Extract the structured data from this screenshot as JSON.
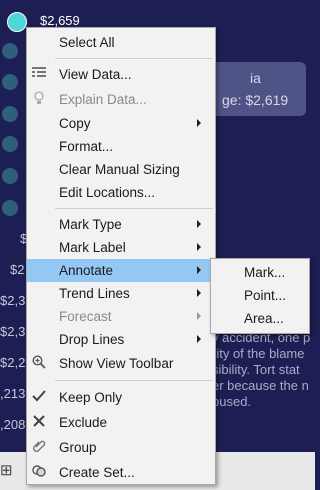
{
  "background": {
    "active_value": "$2,659",
    "tooltip_partial_1": "ia",
    "tooltip_partial_2": "ge: $2,619",
    "left_values": [
      "$",
      "$2",
      "$2,3",
      "$2,3",
      "$2,27",
      ",213",
      ",208"
    ],
    "paragraph_lines": [
      "y accident, one p",
      "rity of the blame",
      "sibility. Tort stat",
      "er because the n",
      "bused."
    ]
  },
  "colors": {
    "background": "#1d1f54",
    "active_dot": "#4fd6d6",
    "menu_highlight": "#93c8f4"
  },
  "menu": {
    "items": [
      {
        "label": "Select All"
      },
      {
        "label": "View Data...",
        "icon": "table-icon"
      },
      {
        "label": "Explain Data...",
        "icon": "lightbulb-icon",
        "disabled": true
      },
      {
        "label": "Copy",
        "submenu": true
      },
      {
        "label": "Format..."
      },
      {
        "label": "Clear Manual Sizing"
      },
      {
        "label": "Edit Locations..."
      },
      {
        "label": "Mark Type",
        "submenu": true
      },
      {
        "label": "Mark Label",
        "submenu": true
      },
      {
        "label": "Annotate",
        "submenu": true,
        "highlighted": true
      },
      {
        "label": "Trend Lines",
        "submenu": true
      },
      {
        "label": "Forecast",
        "submenu": true,
        "disabled": true
      },
      {
        "label": "Drop Lines",
        "submenu": true
      },
      {
        "label": "Show View Toolbar",
        "icon": "zoom-in-icon"
      },
      {
        "label": "Keep Only",
        "icon": "checkmark-icon"
      },
      {
        "label": "Exclude",
        "icon": "x-icon"
      },
      {
        "label": "Group",
        "icon": "paperclip-icon"
      },
      {
        "label": "Create Set...",
        "icon": "set-icon"
      }
    ]
  },
  "annotate_submenu": {
    "items": [
      {
        "label": "Mark..."
      },
      {
        "label": "Point..."
      },
      {
        "label": "Area..."
      }
    ]
  }
}
